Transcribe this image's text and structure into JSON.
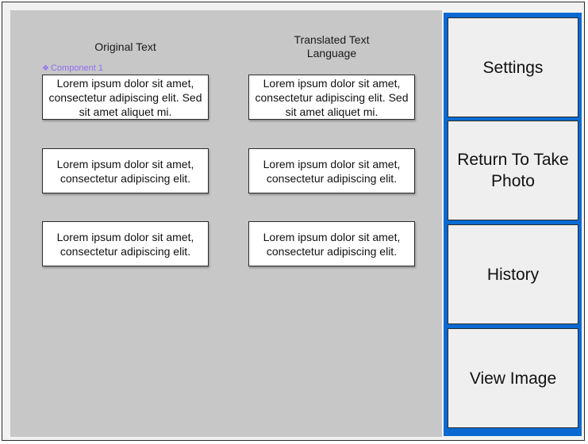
{
  "columns": {
    "original_header": "Original Text",
    "translated_header_line1": "Translated Text",
    "translated_header_line2": "Language"
  },
  "component_label": "Component 1",
  "component_icon": "component-diamond-icon",
  "rows": [
    {
      "original": "Lorem ipsum dolor sit amet, consectetur adipiscing elit. Sed sit amet aliquet mi.",
      "translated": "Lorem ipsum dolor sit amet, consectetur adipiscing elit. Sed sit amet aliquet mi."
    },
    {
      "original": "Lorem ipsum dolor sit amet, consectetur adipiscing elit.",
      "translated": "Lorem ipsum dolor sit amet, consectetur adipiscing elit."
    },
    {
      "original": "Lorem ipsum dolor sit amet, consectetur adipiscing elit.",
      "translated": "Lorem ipsum dolor sit amet, consectetur adipiscing elit."
    }
  ],
  "sidebar": {
    "buttons": [
      {
        "label": "Settings"
      },
      {
        "label": "Return To Take Photo"
      },
      {
        "label": "History"
      },
      {
        "label": "View Image"
      }
    ]
  },
  "colors": {
    "canvas": "#c7c7c7",
    "sidebar_accent": "#0b6ad2",
    "component_label": "#8f6cf5"
  }
}
